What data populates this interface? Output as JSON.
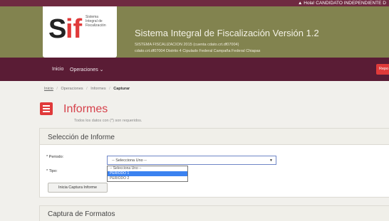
{
  "topbar": {
    "user_greeting": "Hola! CANDIDATO INDEPENDIENTE D"
  },
  "header": {
    "logo": {
      "mark_text": "SIF",
      "lines": [
        "Sistema",
        "Integral de",
        "Fiscalización"
      ]
    },
    "system_title": "Sistema Integral de Fiscalización Versión 1.2",
    "subtitle_line1": "SISTEMA FISCALIZACION 2015 (cuenta cdato.crt.df07004)",
    "subtitle_line2": "cdato.crt.df07004 Distrito 4 Cipulado Federal Campaña Federal Chiapas"
  },
  "nav": {
    "home": "Inicio",
    "operations": "Operaciones ⌄",
    "right_button": "Repo"
  },
  "breadcrumb": {
    "home": "Inicio",
    "items": [
      "Operaciones",
      "Informes"
    ],
    "current": "Capturar"
  },
  "page": {
    "title": "Informes",
    "note": "Todos los datos con (*) son requeridos."
  },
  "selection_panel": {
    "title": "Selección de Informe",
    "periodo_label": "* Periodo:",
    "tipo_label": "* Tipo:",
    "select_value": "-- Selecciona Uno --",
    "dropdown_options": [
      "-- Selecciona Uno --",
      "PERIODO 1",
      "PERIODO 2"
    ],
    "selected_index": 1,
    "init_button": "Inicia Captura Informe"
  },
  "capture_panel": {
    "title": "Captura de Formatos"
  },
  "colors": {
    "top_strip": "#6f2a41",
    "header_band": "#82834f",
    "nav_bar": "#5a1c35",
    "accent_red": "#e03a3a",
    "title_red": "#d6414b",
    "highlight_blue": "#3b82f0"
  }
}
